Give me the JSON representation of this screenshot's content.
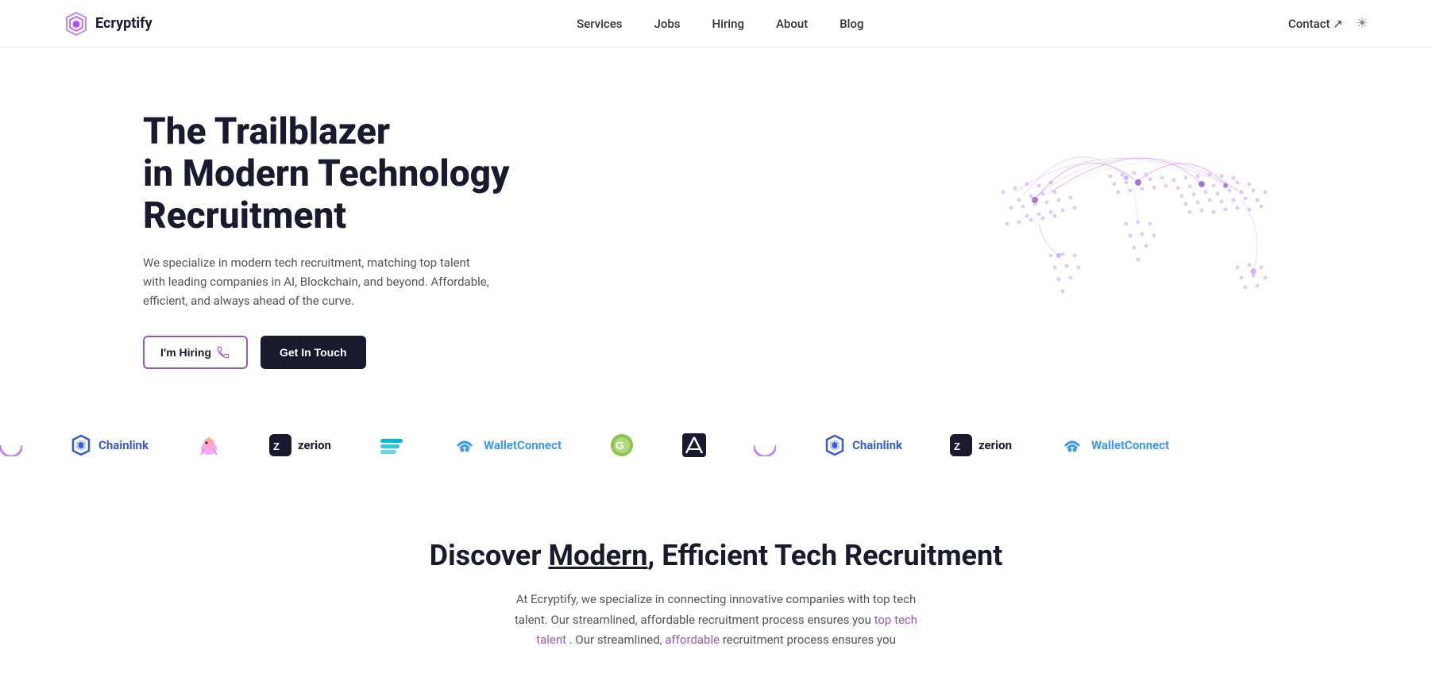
{
  "brand": {
    "name": "Ecryptify",
    "logo_alt": "Ecryptify logo"
  },
  "nav": {
    "links": [
      {
        "label": "Services",
        "href": "#"
      },
      {
        "label": "Jobs",
        "href": "#"
      },
      {
        "label": "Hiring",
        "href": "#"
      },
      {
        "label": "About",
        "href": "#"
      },
      {
        "label": "Blog",
        "href": "#"
      }
    ],
    "contact_label": "Contact ↗",
    "theme_icon": "☀"
  },
  "hero": {
    "title_line1": "The Trailblazer",
    "title_line2": "in Modern Technology Recruitment",
    "subtitle": "We specialize in modern tech recruitment, matching top talent with leading companies in AI, Blockchain, and beyond. Affordable, efficient, and always ahead of the curve.",
    "btn_hiring": "I'm Hiring",
    "btn_touch": "Get In Touch"
  },
  "partners": [
    {
      "name": "Chainlink",
      "color": "#375BD2"
    },
    {
      "name": "Unicorn",
      "color": "#e91e8c"
    },
    {
      "name": "zerion",
      "color": "#0D0D0D"
    },
    {
      "name": "Equalizer",
      "color": "#00bcd4"
    },
    {
      "name": "WalletConnect",
      "color": "#3B99FC"
    },
    {
      "name": "Coingecko",
      "color": "#8DC647"
    },
    {
      "name": "Alkimiya",
      "color": "#1a1a2e"
    }
  ],
  "discover": {
    "title_plain": "Discover ",
    "title_underline": "Modern",
    "title_rest": ", Efficient Tech Recruitment",
    "subtitle": "At Ecryptify, we specialize in connecting innovative companies with top tech talent. Our streamlined, affordable recruitment process ensures you"
  }
}
